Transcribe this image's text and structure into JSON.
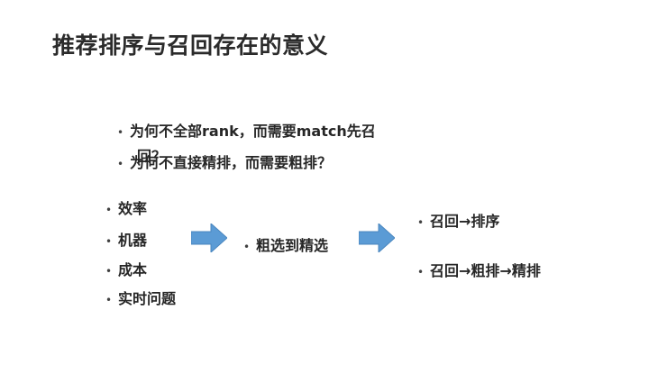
{
  "slide": {
    "title": "推荐排序与召回存在的意义",
    "questions": [
      "为何不全部rank，而需要match先召",
      "回？",
      "为何不直接精排，而需要粗排？"
    ],
    "left_items": [
      "效率",
      "机器",
      "成本",
      "实时问题"
    ],
    "middle_item": "粗选到精选",
    "right_items": [
      "召回→排序",
      "召回→粗排→精排"
    ],
    "bullet_symbol": "•",
    "arrow_color": "#5b9bd5"
  }
}
